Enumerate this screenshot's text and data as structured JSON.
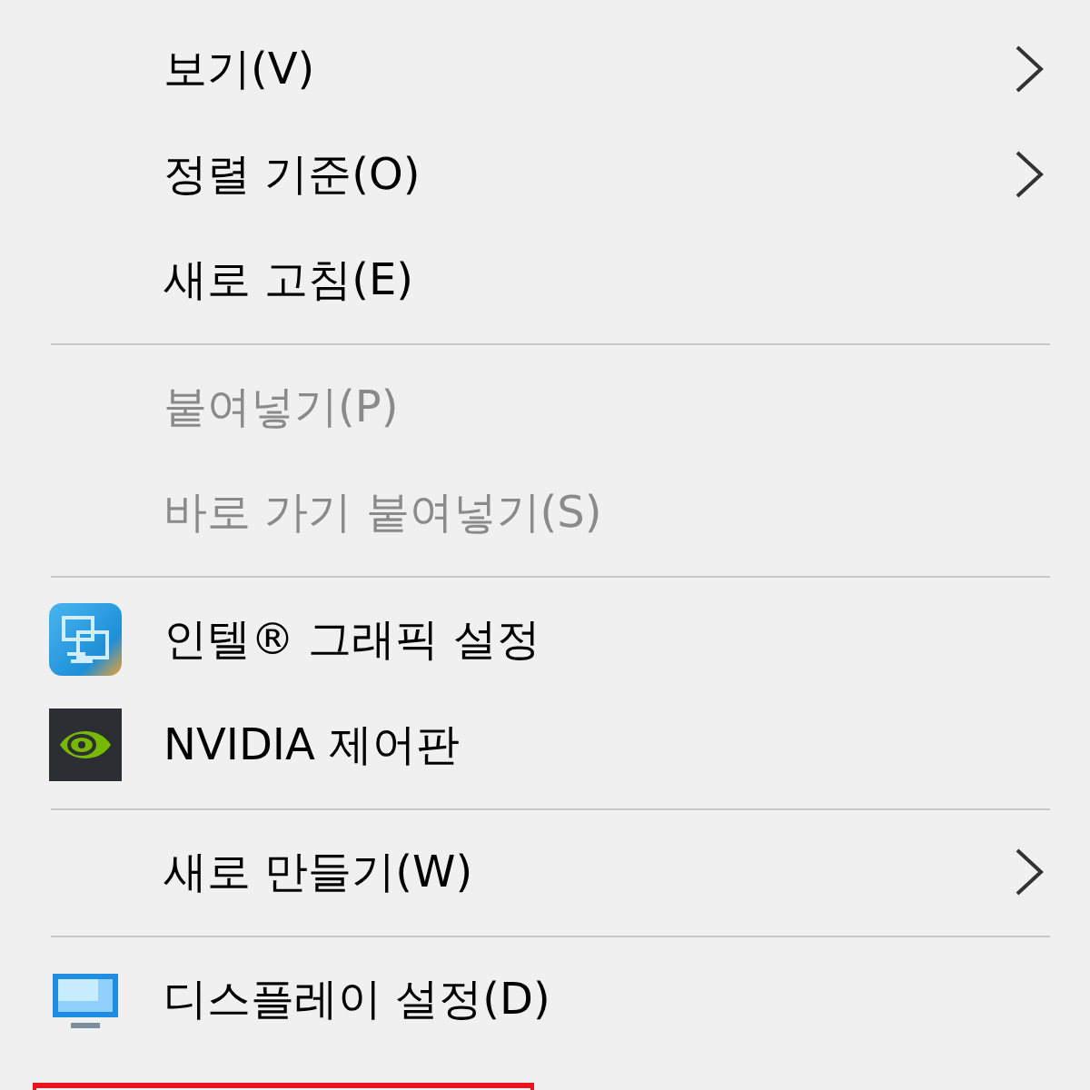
{
  "menu": {
    "groups": [
      {
        "items": [
          {
            "label": "보기(V)",
            "kind": "plain",
            "disabled": false,
            "submenu": true
          },
          {
            "label": "정렬 기준(O)",
            "kind": "plain",
            "disabled": false,
            "submenu": true
          },
          {
            "label": "새로 고침(E)",
            "kind": "plain",
            "disabled": false,
            "submenu": false
          }
        ]
      },
      {
        "items": [
          {
            "label": "붙여넣기(P)",
            "kind": "plain",
            "disabled": true,
            "submenu": false
          },
          {
            "label": "바로 가기 붙여넣기(S)",
            "kind": "plain",
            "disabled": true,
            "submenu": false
          }
        ]
      },
      {
        "items": [
          {
            "label": "인텔® 그래픽 설정",
            "kind": "graphics-app",
            "disabled": false,
            "submenu": false
          },
          {
            "label": "NVIDIA 제어판",
            "kind": "gpu-app",
            "disabled": false,
            "submenu": false
          }
        ]
      },
      {
        "items": [
          {
            "label": "새로 만들기(W)",
            "kind": "plain",
            "disabled": false,
            "submenu": true
          }
        ]
      },
      {
        "items": [
          {
            "label": "디스플레이 설정(D)",
            "kind": "display",
            "disabled": false,
            "submenu": false
          }
        ]
      }
    ]
  }
}
